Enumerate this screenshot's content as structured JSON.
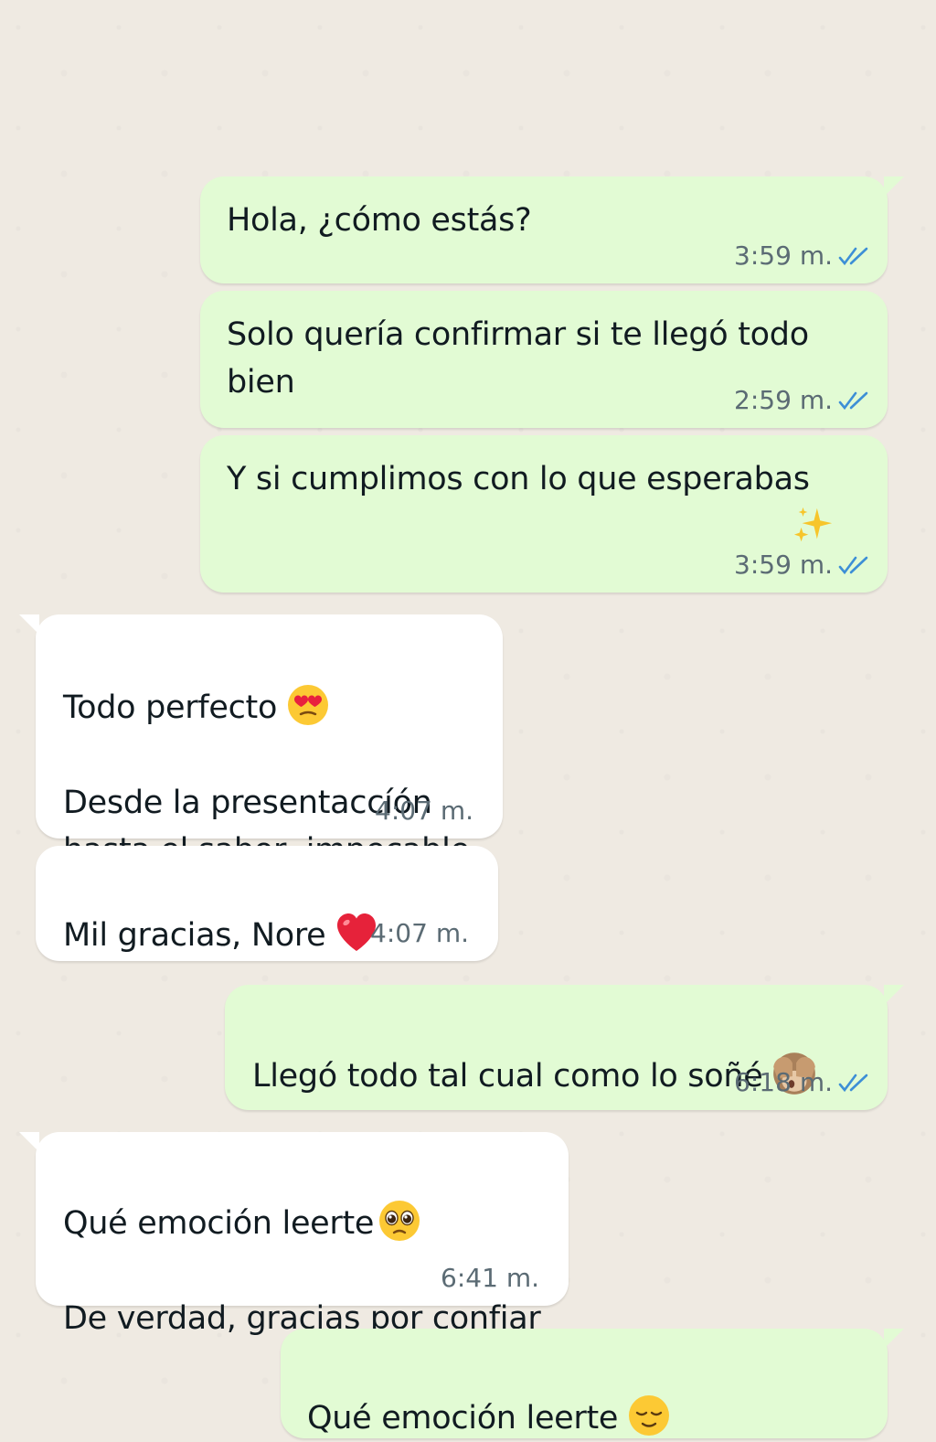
{
  "messages": [
    {
      "id": "m1",
      "direction": "outgoing",
      "text": "Hola, ¿cómo estás?",
      "time": "3:59 m.",
      "status": "read"
    },
    {
      "id": "m2",
      "direction": "outgoing",
      "text": "Solo quería confirmar si te llegó todo\nbien",
      "time": "2:59 m.",
      "status": "read"
    },
    {
      "id": "m3",
      "direction": "outgoing",
      "text": "Y si cumplimos con lo que esperabas",
      "emoji": "sparkles",
      "time": "3:59 m.",
      "status": "read"
    },
    {
      "id": "m4",
      "direction": "incoming",
      "line1": "Todo perfecto",
      "emoji": "heart-eyes-face",
      "line2": "Desde la presentaccíón\nhasta el sabor, impecable.",
      "time": "4:07 m."
    },
    {
      "id": "m5",
      "direction": "incoming",
      "text": "Mil gracias, Nore",
      "emoji": "red-heart",
      "time": "4:07 m."
    },
    {
      "id": "m6",
      "direction": "outgoing",
      "text": "Llegó todo tal cual como lo soñé",
      "emoji": "see-no-evil-monkey",
      "time": "6:18 m.",
      "status": "read"
    },
    {
      "id": "m7",
      "direction": "incoming",
      "line1": "Qué emoción leerte",
      "emoji": "pleading-face",
      "line2": "De verdad, gracias por confiar",
      "time": "6:41 m."
    },
    {
      "id": "m8",
      "direction": "outgoing",
      "text": "Qué emoción leerte",
      "emoji": "relieved-face"
    }
  ],
  "colors": {
    "background": "#efeae2",
    "outgoing_bubble": "#e2fbd4",
    "incoming_bubble": "#ffffff",
    "read_ticks": "#3d8fd6",
    "timestamp": "#5b6b74"
  }
}
